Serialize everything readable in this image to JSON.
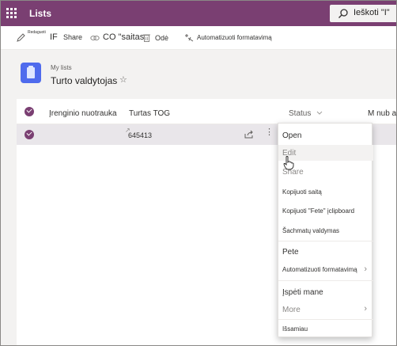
{
  "app": {
    "title": "Lists"
  },
  "search": {
    "label": "Ieškoti \"I\""
  },
  "commandbar": {
    "edit_super": "Redaguoti",
    "edit_label": "IF",
    "share_label": "Share",
    "copylink_label": "CO \"saitas",
    "delete_label": "Odė",
    "automate_label": "Automatizuoti formatavimą"
  },
  "header": {
    "breadcrumb": "My lists",
    "title": "Turto valdytojas"
  },
  "columns": [
    {
      "label": "Įrenginio nuotrauka"
    },
    {
      "label": "Turtas TOG"
    },
    {
      "label": "Status"
    },
    {
      "label": "M nub ac"
    }
  ],
  "row": {
    "value": "645413"
  },
  "menu": {
    "items": [
      {
        "label": "Open"
      },
      {
        "label": "Edit"
      },
      {
        "label": "Share"
      },
      {
        "label": "Kopijuoti saitą"
      },
      {
        "label": "Kopijuoti \"Fete\" įclipboard"
      },
      {
        "label": "Šachmatų valdymas"
      },
      {
        "label": "Pete"
      },
      {
        "label": "Automatizuoti formatavimą"
      },
      {
        "label": "Įspėti mane"
      },
      {
        "label": "More"
      },
      {
        "label": "Išsamiau"
      }
    ]
  },
  "colors": {
    "suite_bar": "#7a3f72",
    "accent": "#7a3f72",
    "list_icon": "#4f6bed"
  }
}
